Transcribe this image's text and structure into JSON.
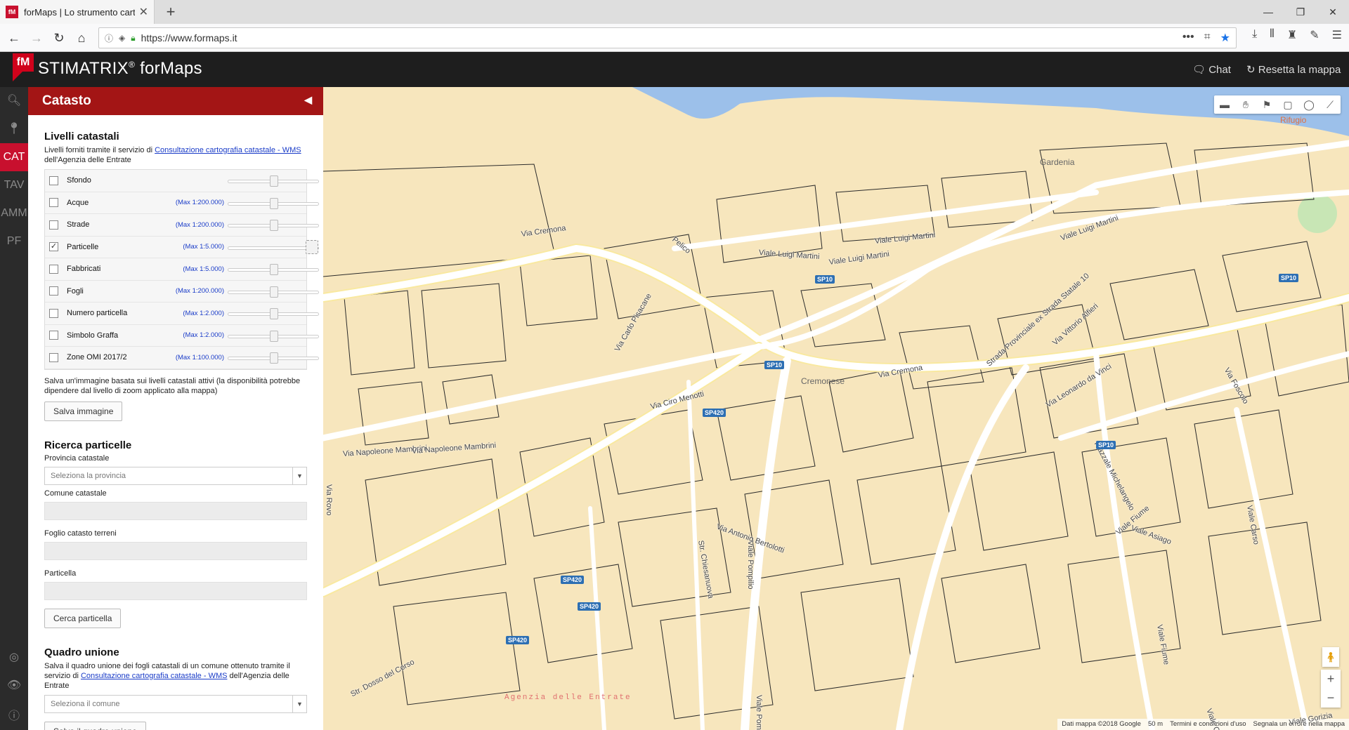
{
  "browser": {
    "tab_title": "forMaps | Lo strumento cartog",
    "url": "https://www.formaps.it"
  },
  "app": {
    "brand": "STIMATRIX",
    "brand_reg": "®",
    "brand_suffix": "forMaps",
    "logo_text": "fM",
    "chat": "Chat",
    "reset": "Resetta la mappa"
  },
  "rail": {
    "items": [
      "CAT",
      "TAV",
      "AMM",
      "PF"
    ]
  },
  "panel": {
    "title": "Catasto",
    "levels": {
      "title": "Livelli catastali",
      "desc_prefix": "Livelli forniti tramite il servizio di",
      "desc_link": "Consultazione cartografia catastale - WMS",
      "desc_suffix": "dell'Agenzia delle Entrate",
      "layers": [
        {
          "name": "Sfondo",
          "max": "",
          "checked": false
        },
        {
          "name": "Acque",
          "max": "(Max 1:200.000)",
          "checked": false
        },
        {
          "name": "Strade",
          "max": "(Max 1:200.000)",
          "checked": false
        },
        {
          "name": "Particelle",
          "max": "(Max 1:5.000)",
          "checked": true
        },
        {
          "name": "Fabbricati",
          "max": "(Max 1:5.000)",
          "checked": false
        },
        {
          "name": "Fogli",
          "max": "(Max 1:200.000)",
          "checked": false
        },
        {
          "name": "Numero particella",
          "max": "(Max 1:2.000)",
          "checked": false
        },
        {
          "name": "Simbolo Graffa",
          "max": "(Max 1:2.000)",
          "checked": false
        },
        {
          "name": "Zone OMI 2017/2",
          "max": "(Max 1:100.000)",
          "checked": false
        }
      ],
      "save_desc": "Salva un'immagine basata sui livelli catastali attivi (la disponibilità potrebbe dipendere dal livello di zoom applicato alla mappa)",
      "save_btn": "Salva immagine"
    },
    "search": {
      "title": "Ricerca particelle",
      "provincia_lbl": "Provincia catastale",
      "provincia_placeholder": "Seleziona la provincia",
      "comune_lbl": "Comune catastale",
      "foglio_lbl": "Foglio catasto terreni",
      "particella_lbl": "Particella",
      "search_btn": "Cerca particella"
    },
    "quadro": {
      "title": "Quadro unione",
      "desc_prefix": "Salva il quadro unione dei fogli catastali di un comune ottenuto tramite il servizio di",
      "desc_link": "Consultazione cartografia catastale - WMS",
      "desc_suffix": "dell'Agenzia delle Entrate",
      "comune_placeholder": "Seleziona il comune",
      "save_btn": "Salva il quadro unione"
    }
  },
  "map": {
    "streets": [
      "Via Cremona",
      "Viale Luigi Martini",
      "Viale Luigi Martini",
      "Viale Luigi Martini",
      "Viale Luigi Martini",
      "Via Napoleone Mambrini",
      "Via Napoleone Mambrini",
      "Str. Dosso del Corso",
      "Viale Pompilio",
      "Viale Pompilio",
      "Strada Provinciale ex Strada Statale 10",
      "Via Cremona",
      "Piazzale Michelangelo",
      "Viale Fiume",
      "Viale Asiago",
      "Via Antonio Bertolotti",
      "Via Carlo Pisacane",
      "Via Ciro Menotti",
      "Str. Chiesanuova",
      "Viale Fiume",
      "Viale Carso",
      "Via Leonardo da Vinci",
      "Via Vittorio Alfieri",
      "Via Foscolo",
      "Via Rovo",
      "Viale Gorizia",
      "Viale Oslavia",
      "Pelico"
    ],
    "badges": [
      "SP10",
      "SP10",
      "SP10",
      "SP10",
      "SP420",
      "SP420",
      "SP420",
      "SP420"
    ],
    "poi": [
      "Rifugio",
      "Gardenia",
      "Cremonese",
      "Agenzia delle Entrate"
    ],
    "attribution": "Dati mappa ©2018 Google",
    "scale": "50 m",
    "terms": "Termini e condizioni d'uso",
    "report": "Segnala un errore nella mappa"
  }
}
